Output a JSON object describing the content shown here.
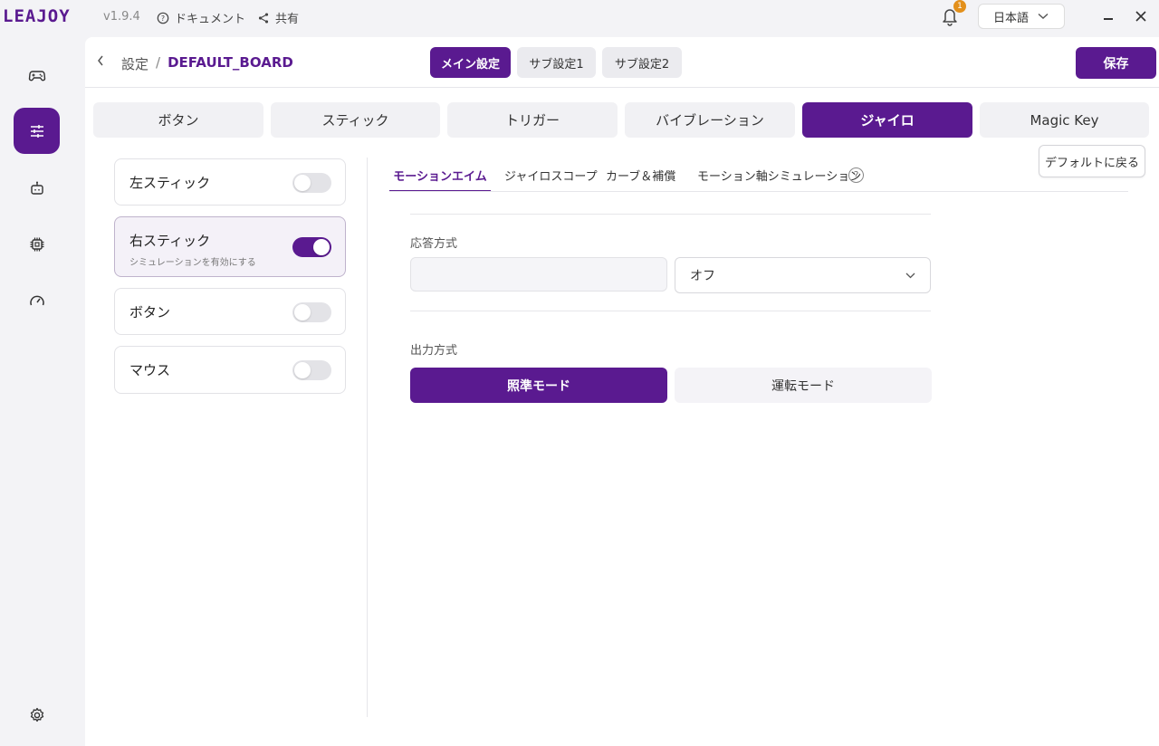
{
  "app": {
    "logo": "LEAJOY",
    "version": "v1.9.4"
  },
  "titlebar": {
    "docs_label": "ドキュメント",
    "share_label": "共有",
    "notifications_count": "1",
    "language": "日本語"
  },
  "breadcrumb": {
    "parent": "設定",
    "separator": "/",
    "current": "DEFAULT_BOARD"
  },
  "config_tabs": [
    "メイン設定",
    "サブ設定1",
    "サブ設定2"
  ],
  "save_label": "保存",
  "category_tabs": [
    "ボタン",
    "スティック",
    "トリガー",
    "バイブレーション",
    "ジャイロ",
    "Magic Key"
  ],
  "reset_label": "デフォルトに戻る",
  "options": [
    {
      "label": "左スティック",
      "enabled": false
    },
    {
      "label": "右スティック",
      "sub": "シミュレーションを有効にする",
      "enabled": true
    },
    {
      "label": "ボタン",
      "enabled": false
    },
    {
      "label": "マウス",
      "enabled": false
    }
  ],
  "sub_tabs": [
    "モーションエイム",
    "ジャイロスコープ",
    "カーブ＆補償",
    "モーション軸シミュレーション"
  ],
  "help_label": "?",
  "response": {
    "label": "応答方式",
    "input_value": "",
    "select_value": "オフ"
  },
  "output": {
    "label": "出力方式",
    "modes": [
      "照準モード",
      "運転モード"
    ]
  },
  "colors": {
    "accent": "#5a1a90",
    "badge": "#e3901c"
  }
}
